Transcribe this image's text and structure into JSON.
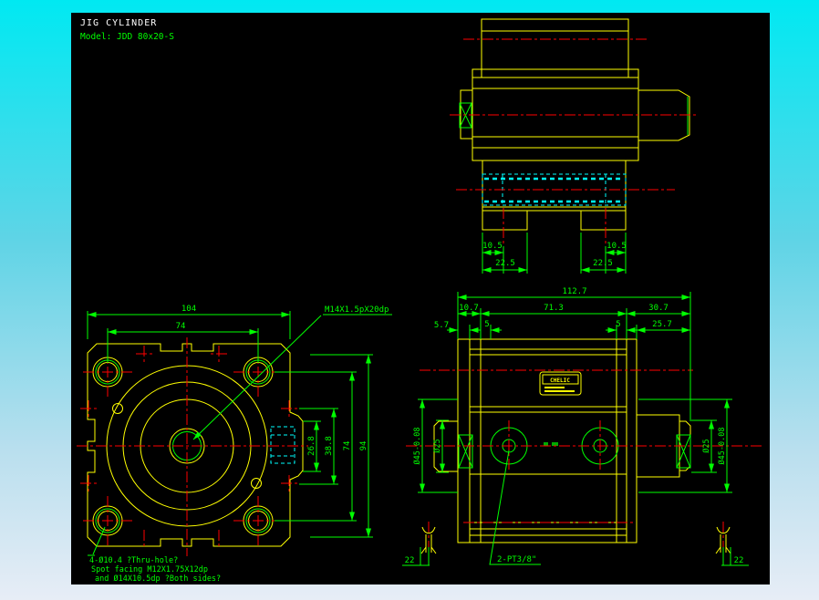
{
  "title": {
    "name": "JIG CYLINDER",
    "model": "Model: JDD 80x20-S"
  },
  "colors": {
    "background_top": "#00e9f2",
    "background_bottom": "#e7edf6",
    "canvas": "#000000",
    "outline": "#ffff00",
    "dimension": "#00ff00",
    "centerline": "#ff0000",
    "hidden_line": "#00ffff",
    "title_text": "#ffffff"
  },
  "top_view": {
    "dim_left_inner": "10.5",
    "dim_left_outer": "22.5",
    "dim_right_inner": "10.5",
    "dim_right_outer": "22.5"
  },
  "front_view": {
    "dim_width": "104",
    "dim_bolt_spacing": "74",
    "thread_label": "M14X1.5pX20dp",
    "dim_boss_small": "26.8",
    "dim_boss_large": "38.8",
    "dim_bolt_vertical": "74",
    "dim_body_height": "94",
    "notes": [
      "4-Ø10.4 ?Thru-hole?",
      "Spot facing  M12X1.75X12dp",
      "and Ø14X10.5dp ?Both sides?"
    ]
  },
  "side_view": {
    "dim_total": "112.7",
    "dim_left_cap": "10.7",
    "dim_body": "71.3",
    "dim_rod_end": "30.7",
    "dim_5_7": "5.7",
    "dim_5_left": "5",
    "dim_5_right": "5",
    "dim_25_7": "25.7",
    "dia_boss_left": "Ø45-0.08",
    "dia_rod_left": "Ø25",
    "dia_rod_right": "Ø25",
    "dia_boss_right": "Ø45-0.08",
    "port_label": "2-PT3/8\"",
    "plug_left": "22",
    "plug_right": "22",
    "nameplate": "CHELIC"
  }
}
